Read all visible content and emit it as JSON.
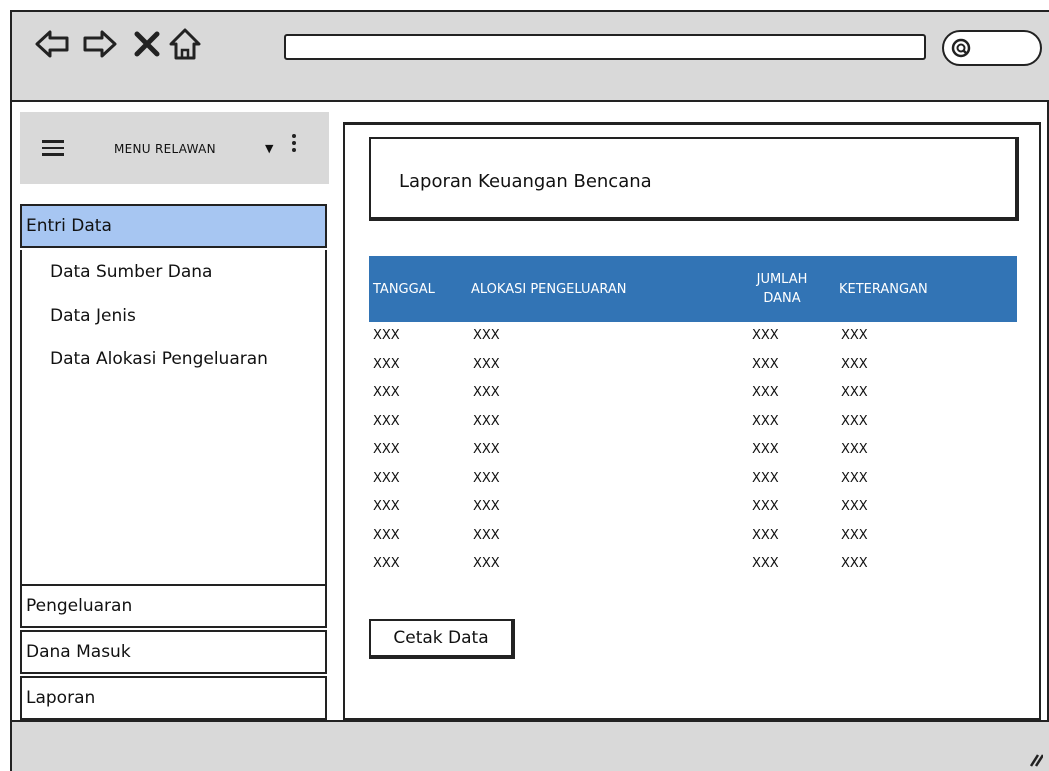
{
  "browser": {
    "nav_icons": [
      "back-arrow-icon",
      "forward-arrow-icon",
      "close-icon",
      "home-icon"
    ],
    "url_value": "",
    "search_icon": "search-icon"
  },
  "sidebar": {
    "menu_title": "MENU RELAWAN",
    "menu_caret": "▼",
    "active_item": "Entri Data",
    "sub_items": [
      "Data Sumber Dana",
      "Data Jenis",
      "Data Alokasi Pengeluaran"
    ],
    "items": [
      "Pengeluaran",
      "Dana Masuk",
      "Laporan"
    ]
  },
  "main": {
    "title": "Laporan Keuangan Bencana",
    "table": {
      "header_color": "#3274b5",
      "columns": [
        "TANGGAL",
        "ALOKASI PENGELUARAN",
        "JUMLAH DANA",
        "KETERANGAN"
      ],
      "rows": [
        [
          "XXX",
          "XXX",
          "XXX",
          "XXX"
        ],
        [
          "XXX",
          "XXX",
          "XXX",
          "XXX"
        ],
        [
          "XXX",
          "XXX",
          "XXX",
          "XXX"
        ],
        [
          "XXX",
          "XXX",
          "XXX",
          "XXX"
        ],
        [
          "XXX",
          "XXX",
          "XXX",
          "XXX"
        ],
        [
          "XXX",
          "XXX",
          "XXX",
          "XXX"
        ],
        [
          "XXX",
          "XXX",
          "XXX",
          "XXX"
        ],
        [
          "XXX",
          "XXX",
          "XXX",
          "XXX"
        ],
        [
          "XXX",
          "XXX",
          "XXX",
          "XXX"
        ]
      ]
    },
    "print_button": "Cetak Data"
  },
  "colors": {
    "chrome": "#d9d9d9",
    "active_item": "#a7c6f2"
  }
}
